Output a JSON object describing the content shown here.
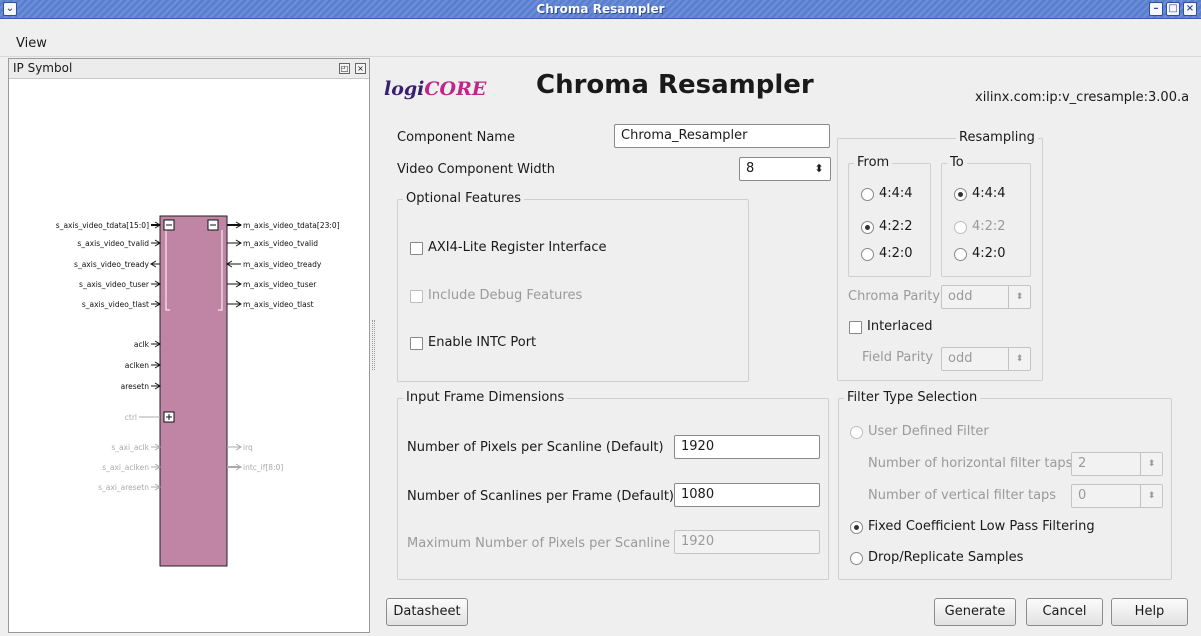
{
  "window": {
    "title": "Chroma Resampler"
  },
  "menu": {
    "view": "View"
  },
  "ip_symbol": {
    "title": "IP Symbol",
    "left_ports": [
      {
        "name": "s_axis_video_tdata[15:0]",
        "dir": "in",
        "bus": true,
        "enabled": true
      },
      {
        "name": "s_axis_video_tvalid",
        "dir": "in",
        "enabled": true
      },
      {
        "name": "s_axis_video_tready",
        "dir": "out",
        "enabled": true
      },
      {
        "name": "s_axis_video_tuser",
        "dir": "in",
        "enabled": true
      },
      {
        "name": "s_axis_video_tlast",
        "dir": "in",
        "enabled": true
      },
      {
        "name": "aclk",
        "dir": "in",
        "enabled": true
      },
      {
        "name": "aclken",
        "dir": "in",
        "enabled": true
      },
      {
        "name": "aresetn",
        "dir": "in",
        "enabled": true
      },
      {
        "name": "ctrl",
        "dir": "bi",
        "enabled": false
      },
      {
        "name": "s_axi_aclk",
        "dir": "in",
        "enabled": false
      },
      {
        "name": "s_axi_aclken",
        "dir": "in",
        "enabled": false
      },
      {
        "name": "s_axi_aresetn",
        "dir": "in",
        "enabled": false
      }
    ],
    "right_ports": [
      {
        "name": "m_axis_video_tdata[23:0]",
        "dir": "out",
        "bus": true,
        "enabled": true
      },
      {
        "name": "m_axis_video_tvalid",
        "dir": "out",
        "enabled": true
      },
      {
        "name": "m_axis_video_tready",
        "dir": "in",
        "enabled": true
      },
      {
        "name": "m_axis_video_tuser",
        "dir": "out",
        "enabled": true
      },
      {
        "name": "m_axis_video_tlast",
        "dir": "out",
        "enabled": true
      },
      {
        "name": "irq",
        "dir": "out",
        "enabled": false
      },
      {
        "name": "intc_if[8:0]",
        "dir": "out",
        "bus": true,
        "enabled": false
      }
    ],
    "block_color": "#c085a5"
  },
  "header": {
    "logo_logi": "logi",
    "logo_core": "CORE",
    "title": "Chroma Resampler",
    "vlnv": "xilinx.com:ip:v_cresample:3.00.a"
  },
  "component_name": {
    "label": "Component Name",
    "value": "Chroma_Resampler"
  },
  "video_width": {
    "label": "Video Component Width",
    "value": "8"
  },
  "optional": {
    "title": "Optional Features",
    "axi4_lite": "AXI4-Lite Register Interface",
    "debug": "Include Debug Features",
    "intc": "Enable INTC Port"
  },
  "resampling": {
    "title": "Resampling",
    "from_title": "From",
    "to_title": "To",
    "from_options": [
      "4:4:4",
      "4:2:2",
      "4:2:0"
    ],
    "to_options": [
      "4:4:4",
      "4:2:2",
      "4:2:0"
    ],
    "from_selected": "4:2:2",
    "to_selected": "4:4:4",
    "chroma_parity_label": "Chroma Parity",
    "chroma_parity_value": "odd",
    "interlaced": "Interlaced",
    "field_parity_label": "Field Parity",
    "field_parity_value": "odd"
  },
  "frame": {
    "title": "Input Frame Dimensions",
    "pixels_label": "Number of Pixels per Scanline (Default)",
    "pixels_value": "1920",
    "lines_label": "Number of Scanlines per Frame (Default)",
    "lines_value": "1080",
    "max_label": "Maximum Number of Pixels per Scanline",
    "max_value": "1920"
  },
  "filter": {
    "title": "Filter Type Selection",
    "user_defined": "User Defined Filter",
    "htaps_label": "Number of horizontal filter taps",
    "htaps_value": "2",
    "vtaps_label": "Number of vertical filter taps",
    "vtaps_value": "0",
    "fixed": "Fixed Coefficient Low Pass Filtering",
    "drop": "Drop/Replicate Samples",
    "selected": "Fixed Coefficient Low Pass Filtering"
  },
  "buttons": {
    "datasheet": "Datasheet",
    "generate": "Generate",
    "cancel": "Cancel",
    "help": "Help"
  }
}
